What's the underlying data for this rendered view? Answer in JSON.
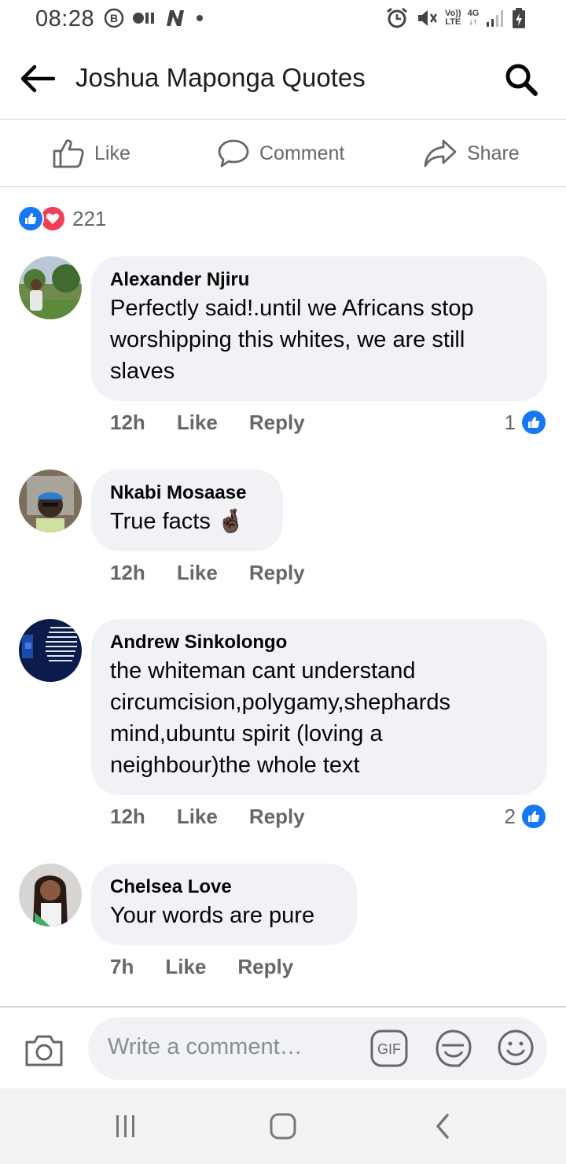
{
  "status_bar": {
    "time": "08:28",
    "network_label_top": "Vo))",
    "network_label_bottom": "LTE",
    "gen_label": "4G"
  },
  "header": {
    "title": "Joshua Maponga Quotes"
  },
  "actions": {
    "like_label": "Like",
    "comment_label": "Comment",
    "share_label": "Share"
  },
  "reactions": {
    "count": "221"
  },
  "comments": [
    {
      "author": "Alexander Njiru",
      "lines": [
        "Perfectly said!.until we Africans stop",
        "worshipping this whites, we are still",
        "slaves"
      ],
      "time": "12h",
      "like_label": "Like",
      "reply_label": "Reply",
      "likes": "1"
    },
    {
      "author": "Nkabi Mosaase",
      "lines": [
        "True facts 🤞🏿"
      ],
      "time": "12h",
      "like_label": "Like",
      "reply_label": "Reply",
      "likes": ""
    },
    {
      "author": "Andrew Sinkolongo",
      "lines": [
        "the whiteman cant understand",
        "circumcision,polygamy,shephards",
        "mind,ubuntu spirit (loving a",
        "neighbour)the whole text"
      ],
      "time": "12h",
      "like_label": "Like",
      "reply_label": "Reply",
      "likes": "2"
    },
    {
      "author": "Chelsea Love",
      "lines": [
        "Your words are pure"
      ],
      "time": "7h",
      "like_label": "Like",
      "reply_label": "Reply",
      "likes": ""
    }
  ],
  "composer": {
    "placeholder": "Write a comment…",
    "gif_label": "GIF"
  },
  "colors": {
    "like_blue": "#1877f2",
    "love_red": "#f33e58",
    "bubble_gray": "#f0f2f5",
    "meta_gray": "#65676b"
  },
  "icons": [
    "back-arrow-icon",
    "search-icon",
    "thumbs-up-icon",
    "comment-icon",
    "share-icon",
    "camera-icon",
    "gif-icon",
    "sticker-icon",
    "emoji-icon",
    "recents-icon",
    "home-icon",
    "back-icon"
  ]
}
